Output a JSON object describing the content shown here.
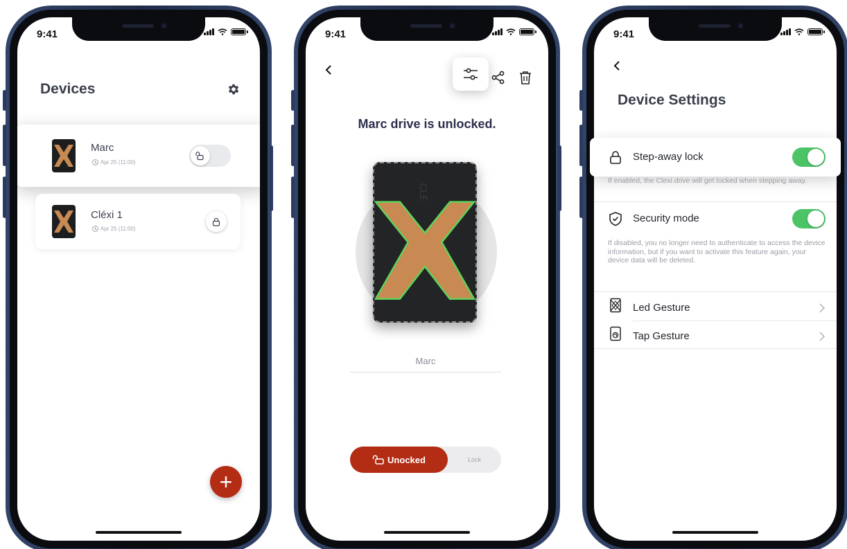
{
  "status": {
    "time": "9:41"
  },
  "devices_screen": {
    "title": "Devices",
    "devices": [
      {
        "name": "Marc",
        "date": "Apr 25 (11:00)",
        "lock_state": "unlocked"
      },
      {
        "name": "Cléxi 1",
        "date": "Apr 25 (11:00)",
        "lock_state": "locked"
      }
    ],
    "fab_label": "+"
  },
  "drive_screen": {
    "status_message": "Marc drive is unlocked.",
    "drive_name": "Marc",
    "drive_brand_text": "CLÉ",
    "segment": {
      "unlocked_label": "Unocked",
      "lock_label": "Lock",
      "selected": "unlocked"
    }
  },
  "settings_screen": {
    "title": "Device Settings",
    "step_away": {
      "label": "Step-away lock",
      "enabled": true,
      "hint": "If enabled, the Clexi drive will get locked when stepping away."
    },
    "security_mode": {
      "label": "Security mode",
      "enabled": true,
      "hint": "If disabled, you no longer need to authenticate to access the device information, but if you want to activate this feature again, your device data will be deleted."
    },
    "gestures": [
      {
        "label": "Led Gesture",
        "icon": "led-gesture-icon"
      },
      {
        "label": "Tap Gesture",
        "icon": "tap-gesture-icon"
      }
    ]
  },
  "colors": {
    "accent": "#b32d14",
    "toggle_on": "#4cc466",
    "drive_copper": "#c88a52",
    "drive_glow": "#5ed45a",
    "phone_frame": "#2a3a5e"
  }
}
